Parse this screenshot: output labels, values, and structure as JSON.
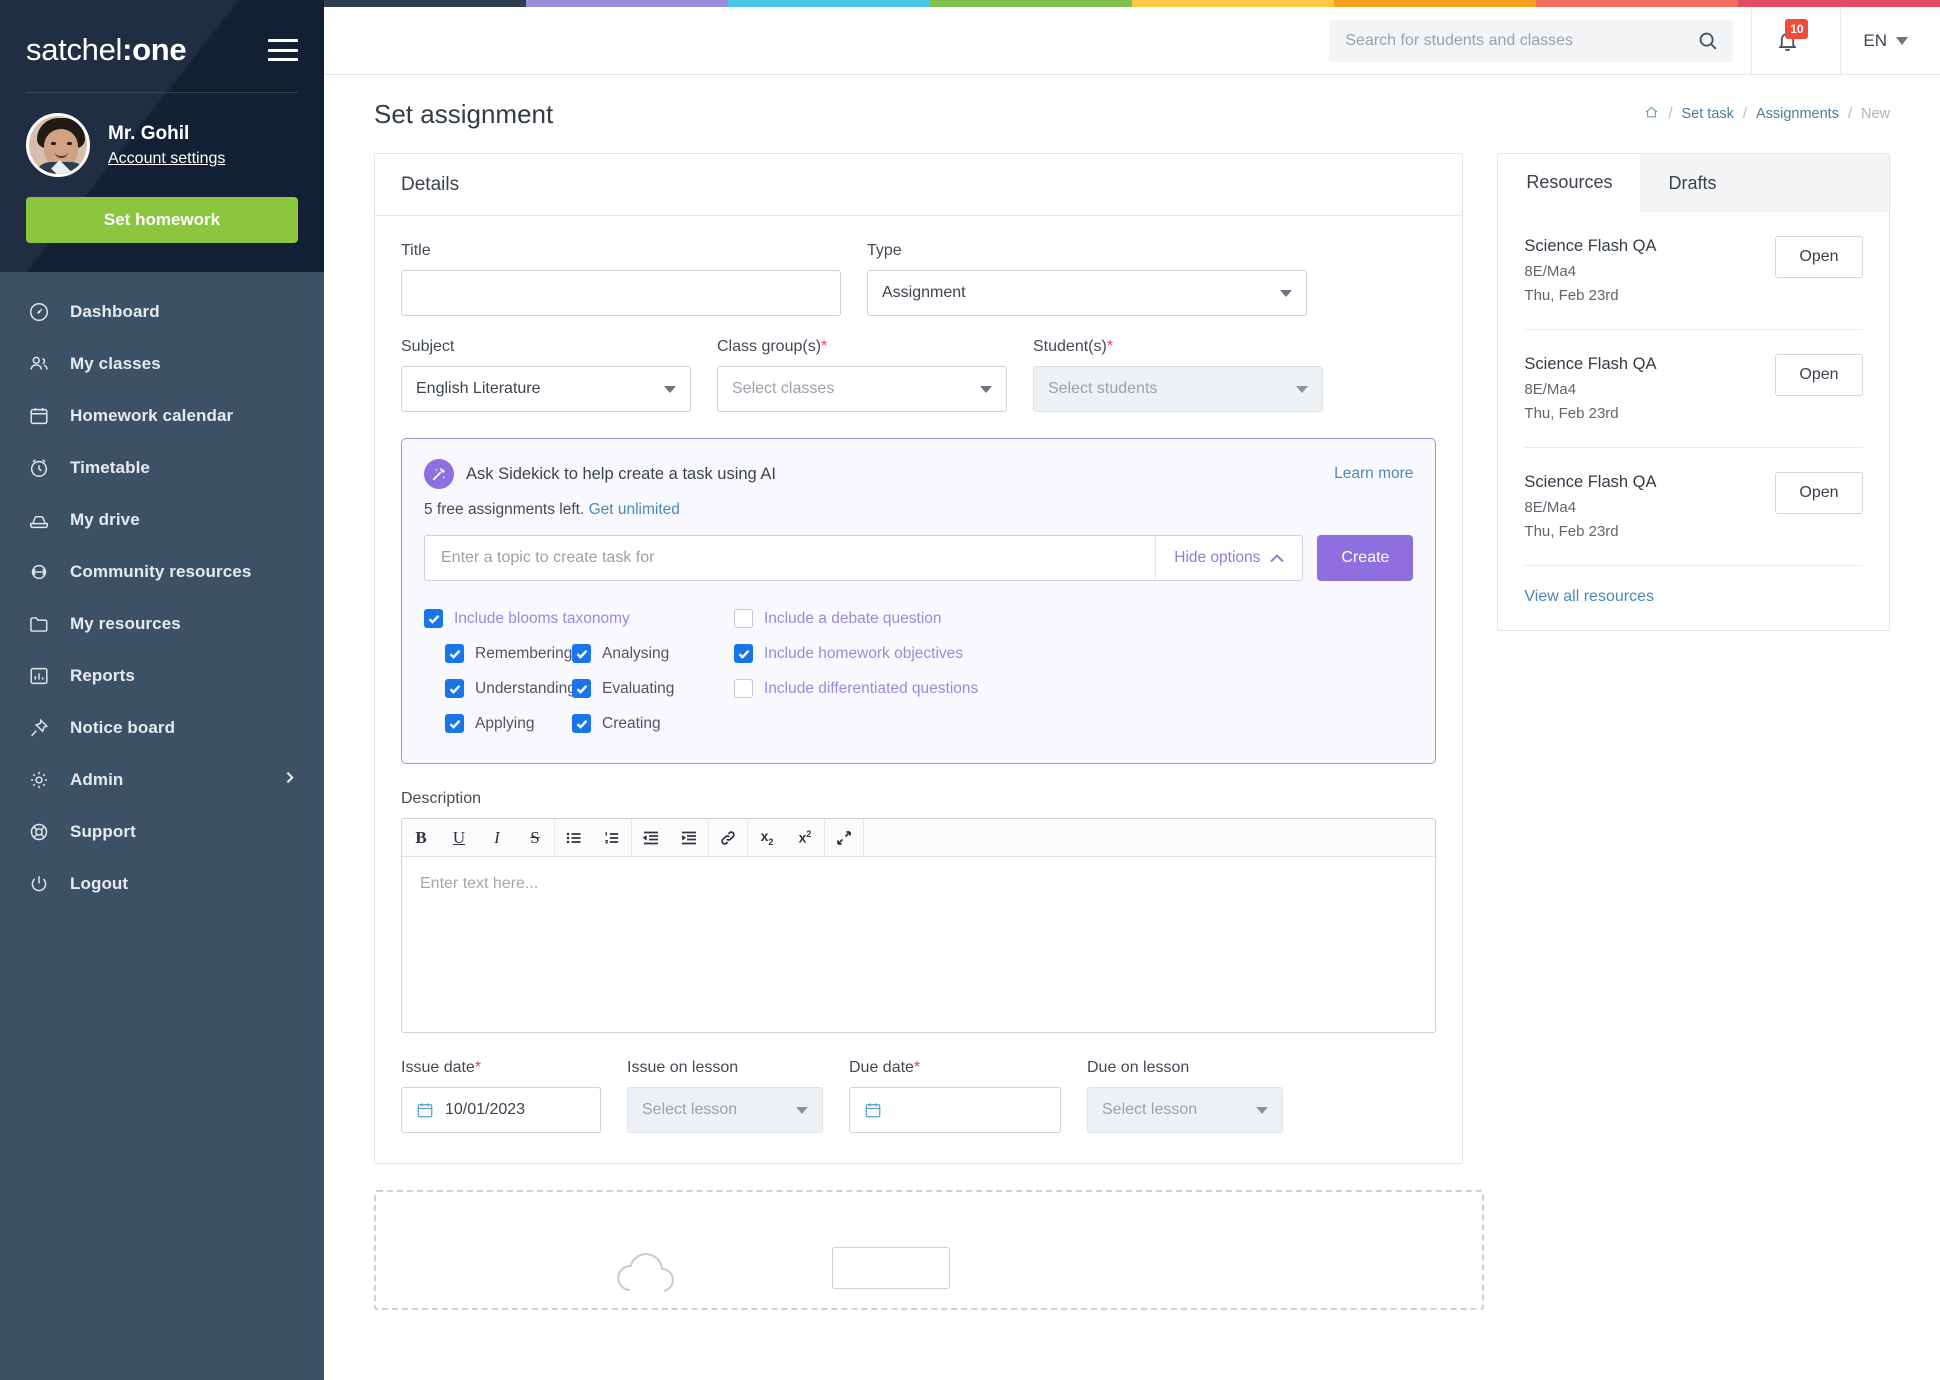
{
  "brand": {
    "name_light": "satchel",
    "name_bold": ":one"
  },
  "user": {
    "name": "Mr. Gohil",
    "account_link": "Account settings"
  },
  "cta": {
    "set_homework": "Set homework"
  },
  "sidebar": {
    "items": [
      {
        "label": "Dashboard",
        "icon": "dashboard-icon"
      },
      {
        "label": "My classes",
        "icon": "people-icon"
      },
      {
        "label": "Homework calendar",
        "icon": "calendar-icon"
      },
      {
        "label": "Timetable",
        "icon": "clock-icon"
      },
      {
        "label": "My drive",
        "icon": "drive-icon"
      },
      {
        "label": "Community resources",
        "icon": "share-icon"
      },
      {
        "label": "My resources",
        "icon": "folder-icon"
      },
      {
        "label": "Reports",
        "icon": "chart-icon"
      },
      {
        "label": "Notice board",
        "icon": "pin-icon"
      },
      {
        "label": "Admin",
        "icon": "gear-icon",
        "chevron": true
      },
      {
        "label": "Support",
        "icon": "lifebuoy-icon"
      },
      {
        "label": "Logout",
        "icon": "power-icon"
      }
    ]
  },
  "topbar": {
    "search_placeholder": "Search for students and classes",
    "search_value": "",
    "notification_count": "10",
    "language": "EN"
  },
  "page": {
    "title": "Set assignment",
    "breadcrumb": [
      {
        "label": "",
        "icon": "home-icon"
      },
      {
        "label": "Set task"
      },
      {
        "label": "Assignments"
      },
      {
        "label": "New",
        "current": true
      }
    ],
    "breadcrumb_sep": "/"
  },
  "details": {
    "heading": "Details",
    "title_label": "Title",
    "title_value": "",
    "title_placeholder": "",
    "type_label": "Type",
    "type_value": "Assignment",
    "subject_label": "Subject",
    "subject_value": "English Literature",
    "class_label": "Class group(s)",
    "class_placeholder": "Select classes",
    "student_label": "Student(s)",
    "student_placeholder": "Select students",
    "required_mark": "*"
  },
  "sidekick": {
    "title": "Ask Sidekick to help create a task using AI",
    "learn_more": "Learn more",
    "quota_text": "5 free assignments left.",
    "quota_link": "Get unlimited",
    "topic_placeholder": "Enter a topic to create task for",
    "topic_value": "",
    "hide_options": "Hide options",
    "create_button": "Create",
    "accent_color": "#8f6fe0",
    "options_left": [
      {
        "label": "Include blooms taxonomy",
        "checked": true,
        "level": 0
      }
    ],
    "blooms": [
      {
        "label": "Remembering",
        "checked": true
      },
      {
        "label": "Analysing",
        "checked": true
      },
      {
        "label": "Understanding",
        "checked": true
      },
      {
        "label": "Evaluating",
        "checked": true
      },
      {
        "label": "Applying",
        "checked": true
      },
      {
        "label": "Creating",
        "checked": true
      }
    ],
    "options_right": [
      {
        "label": "Include a debate question",
        "checked": false
      },
      {
        "label": "Include homework objectives",
        "checked": true
      },
      {
        "label": "Include differentiated questions",
        "checked": false
      }
    ]
  },
  "description": {
    "label": "Description",
    "placeholder": "Enter text here...",
    "value": "",
    "toolbar": [
      {
        "name": "bold-icon",
        "glyph": "B"
      },
      {
        "name": "underline-icon",
        "glyph": "U"
      },
      {
        "name": "italic-icon",
        "glyph": "I"
      },
      {
        "name": "strikethrough-icon",
        "glyph": "S"
      },
      {
        "name": "bullet-list-icon",
        "glyph": ""
      },
      {
        "name": "numbered-list-icon",
        "glyph": ""
      },
      {
        "name": "outdent-icon",
        "glyph": ""
      },
      {
        "name": "indent-icon",
        "glyph": ""
      },
      {
        "name": "link-icon",
        "glyph": ""
      },
      {
        "name": "subscript-icon",
        "glyph": "x"
      },
      {
        "name": "superscript-icon",
        "glyph": "x"
      },
      {
        "name": "expand-icon",
        "glyph": ""
      }
    ]
  },
  "dates": {
    "issue_label": "Issue date",
    "issue_value": "10/01/2023",
    "issue_lesson_label": "Issue on lesson",
    "issue_lesson_placeholder": "Select lesson",
    "due_label": "Due date",
    "due_value": "",
    "due_lesson_label": "Due on lesson",
    "due_lesson_placeholder": "Select lesson",
    "required_mark": "*"
  },
  "resources_panel": {
    "tabs": [
      {
        "label": "Resources",
        "active": true
      },
      {
        "label": "Drafts",
        "active": false
      }
    ],
    "items": [
      {
        "name": "Science Flash QA",
        "class": "8E/Ma4",
        "date": "Thu, Feb 23rd",
        "action": "Open"
      },
      {
        "name": "Science Flash QA",
        "class": "8E/Ma4",
        "date": "Thu, Feb 23rd",
        "action": "Open"
      },
      {
        "name": "Science Flash QA",
        "class": "8E/Ma4",
        "date": "Thu, Feb 23rd",
        "action": "Open"
      }
    ],
    "view_all": "View all resources"
  },
  "rainbow_colors": [
    "#2d3e50",
    "#9b8ad8",
    "#49c6e8",
    "#7fbf4d",
    "#fbc943",
    "#f5a11b",
    "#f4705a",
    "#e34b62"
  ]
}
